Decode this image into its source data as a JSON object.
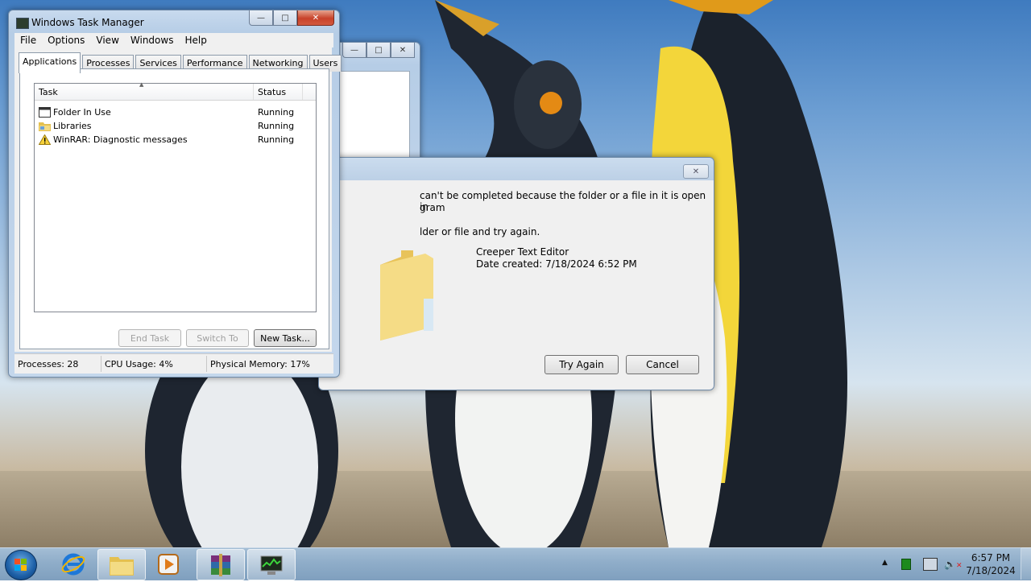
{
  "task_manager": {
    "title": "Windows Task Manager",
    "menu": [
      "File",
      "Options",
      "View",
      "Windows",
      "Help"
    ],
    "tabs": [
      "Applications",
      "Processes",
      "Services",
      "Performance",
      "Networking",
      "Users"
    ],
    "active_tab": "Applications",
    "columns": {
      "task": "Task",
      "status": "Status"
    },
    "rows": [
      {
        "task": "Folder In Use",
        "status": "Running",
        "icon": "window-icon"
      },
      {
        "task": "Libraries",
        "status": "Running",
        "icon": "folder-icon"
      },
      {
        "task": "WinRAR: Diagnostic messages",
        "status": "Running",
        "icon": "warning-icon"
      }
    ],
    "buttons": {
      "end_task": "End Task",
      "switch_to": "Switch To",
      "new_task": "New Task..."
    },
    "status": {
      "processes": "Processes: 28",
      "cpu": "CPU Usage: 4%",
      "memory": "Physical Memory: 17%"
    }
  },
  "dialog": {
    "line1": "can't be completed because the folder or a file in it is open in",
    "line2": "gram",
    "line3": "lder or file and try again.",
    "file_name": "Creeper Text Editor",
    "date_created": "Date created: 7/18/2024 6:52 PM",
    "try_again": "Try Again",
    "cancel": "Cancel"
  },
  "taskbar": {
    "clock_time": "6:57 PM",
    "clock_date": "7/18/2024",
    "pinned": [
      "internet-explorer-icon",
      "windows-explorer-icon",
      "media-player-icon",
      "winrar-icon",
      "task-manager-icon"
    ]
  },
  "colors": {
    "taskbar": "#8fadc9",
    "close_button": "#c8422a",
    "title_bar": "#c8daee"
  }
}
